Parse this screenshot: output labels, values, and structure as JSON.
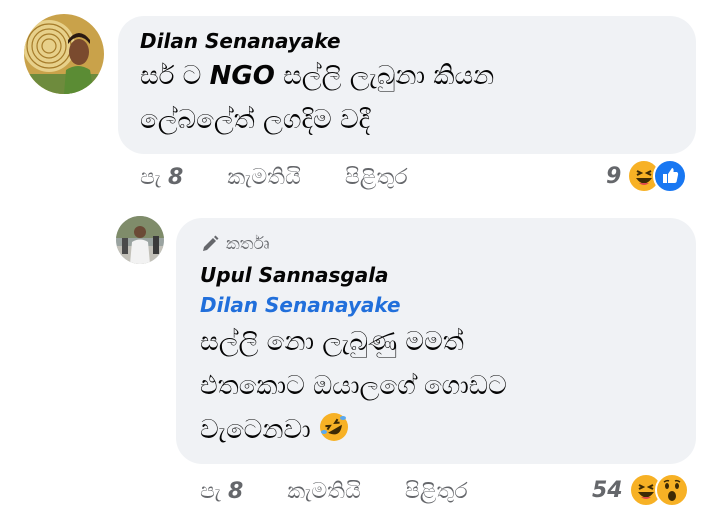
{
  "comment": {
    "author": "Dilan Senanayake",
    "text_line1_a": "සර් ට ",
    "text_line1_bold": "NGO",
    "text_line1_b": " සල්ලි ලැබුනා කියන",
    "text_line2": "ලේබලේත් ලගදිම වදී",
    "actions": {
      "age_prefix": "පැ ",
      "age_num": "8",
      "like": "කැමතියි",
      "reply": "පිළිතුර"
    },
    "reaction_count": "9",
    "reactions": [
      "laugh-emoji",
      "like-emoji"
    ]
  },
  "reply": {
    "badge": "කර්තෘ",
    "author": "Upul Sannasgala",
    "mention": "Dilan Senanayake",
    "text_line1": "සල්ලි නො ලැබුණු මමත්",
    "text_line2": "එතකොට ඔයාලගේ ගොඩට",
    "text_line3": "වැටෙනවා ",
    "inline_emoji": "rolling-laugh-emoji",
    "actions": {
      "age_prefix": "පැ ",
      "age_num": "8",
      "like": "කැමතියි",
      "reply": "පිළිතුර"
    },
    "reaction_count": "54",
    "reactions": [
      "laugh-emoji",
      "wow-emoji"
    ]
  },
  "colors": {
    "bubble": "#f0f2f5",
    "secondary_text": "#65676b",
    "mention": "#216fdb",
    "like_blue": "#1877f2",
    "emoji_yellow": "#f7b125"
  }
}
